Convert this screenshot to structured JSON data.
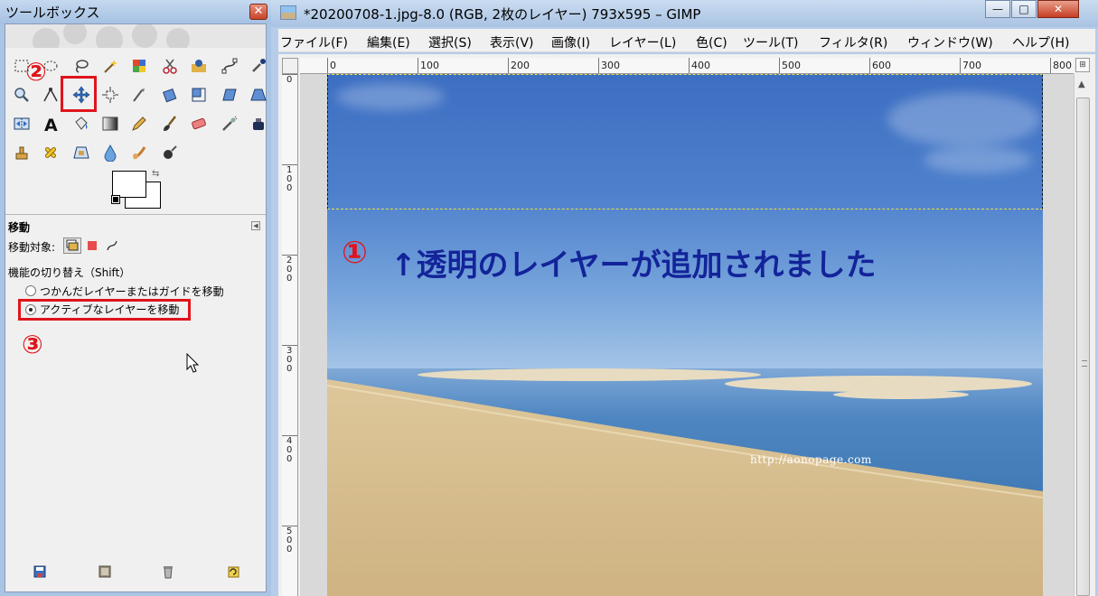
{
  "toolbox": {
    "title": "ツールボックス",
    "close_glyph": "✕",
    "tools": [
      "rect-select-icon",
      "lasso-icon",
      "fuzzy-select-icon",
      "select-by-color-icon",
      "scissors-select-icon",
      "foreground-select-icon",
      "paths-icon",
      "color-picker-icon",
      "zoom-icon",
      "measure-icon",
      "move-icon",
      "align-icon",
      "crop-icon",
      "rotate-icon",
      "scale-icon",
      "shear-icon",
      "perspective-icon",
      "flip-icon",
      "text-icon",
      "bucket-fill-icon",
      "blend-icon",
      "pencil-icon",
      "paintbrush-icon",
      "eraser-icon",
      "airbrush-icon",
      "ink-icon",
      "clone-icon",
      "heal-icon",
      "perspective-clone-icon",
      "blur-icon",
      "smudge-icon",
      "dodge-burn-icon"
    ],
    "badge_2": "②",
    "badge_3": "③",
    "options": {
      "title": "移動",
      "collapse_glyph": "◀",
      "target_label": "移動対象:",
      "switch_label": "機能の切り替え（Shift）",
      "radio_1": "つかんだレイヤーまたはガイドを移動",
      "radio_2": "アクティブなレイヤーを移動",
      "radio_selected": 2
    },
    "bottom_icons": [
      "save-icon",
      "restore-icon",
      "delete-icon",
      "reset-icon"
    ]
  },
  "image_window": {
    "title": "*20200708-1.jpg-8.0 (RGB, 2枚のレイヤー) 793x595 – GIMP",
    "minimize_glyph": "—",
    "maximize_glyph": "□",
    "close_glyph": "✕",
    "menu": [
      "ファイル(F)",
      "編集(E)",
      "選択(S)",
      "表示(V)",
      "画像(I)",
      "レイヤー(L)",
      "色(C)",
      "ツール(T)",
      "フィルタ(R)",
      "ウィンドウ(W)",
      "ヘルプ(H)"
    ],
    "ruler_top": [
      "0",
      "100",
      "200",
      "300",
      "400",
      "500",
      "600",
      "700",
      "800"
    ],
    "ruler_left": [
      "0",
      "1\n0\n0",
      "2\n0\n0",
      "3\n0\n0",
      "4\n0\n0",
      "5\n0\n0"
    ],
    "annotation_number": "①",
    "annotation_text": "↑透明のレイヤーが追加されました",
    "watermark": "http://aonopage.com"
  },
  "colors": {
    "accent_red": "#e0141b",
    "annotation_blue": "#13249a"
  }
}
